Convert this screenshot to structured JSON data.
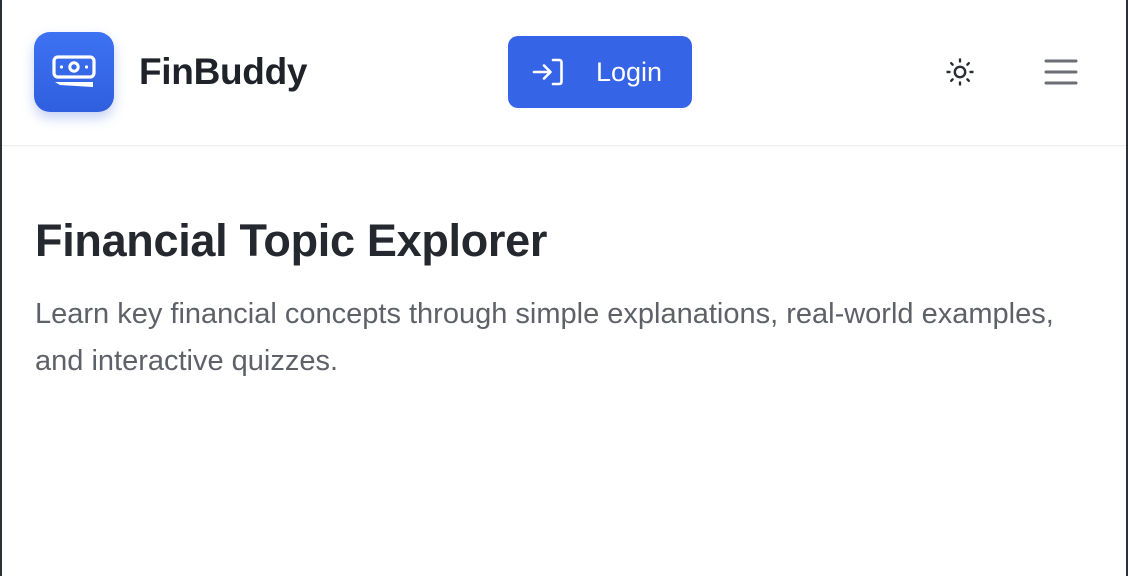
{
  "app": {
    "name": "FinBuddy"
  },
  "header": {
    "login_label": "Login",
    "icons": {
      "logo": "money-bill-icon",
      "login": "sign-in-icon",
      "theme": "sun-icon",
      "menu": "hamburger-menu-icon"
    }
  },
  "main": {
    "title": "Financial Topic Explorer",
    "subtitle": "Learn key financial concepts through simple explanations, real-world examples, and interactive quizzes."
  },
  "colors": {
    "accent": "#3564e6",
    "logo_gradient_top": "#3d72f2",
    "logo_gradient_bottom": "#2f5fdf",
    "title_text": "#25282e",
    "body_text": "#5e6168",
    "frame_border": "#2b2f36"
  }
}
